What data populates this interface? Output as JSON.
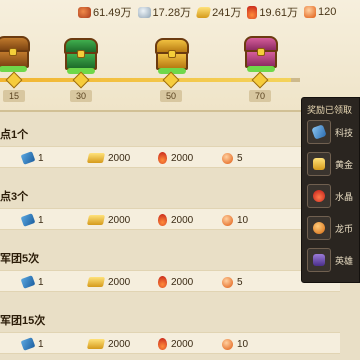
{
  "resources": [
    {
      "icon": "meat-icon",
      "value": "61.49万"
    },
    {
      "icon": "stone-icon",
      "value": "17.28万"
    },
    {
      "icon": "gold-bar-icon",
      "value": "241万"
    },
    {
      "icon": "flame-crystal-icon",
      "value": "19.61万"
    },
    {
      "icon": "orb-coin-icon",
      "value": "120"
    }
  ],
  "milestones": [
    {
      "label": "15",
      "chest": "brown"
    },
    {
      "label": "30",
      "chest": "green"
    },
    {
      "label": "50",
      "chest": "gold"
    },
    {
      "label": "70",
      "chest": "pink"
    }
  ],
  "progress_fraction": 0.97,
  "tasks": [
    {
      "title": "点1个",
      "rewards": [
        "1",
        "2000",
        "2000",
        "5"
      ]
    },
    {
      "title": "点3个",
      "rewards": [
        "1",
        "2000",
        "2000",
        "10"
      ]
    },
    {
      "title": "军团5次",
      "rewards": [
        "1",
        "2000",
        "2000",
        "5"
      ]
    },
    {
      "title": "军团15次",
      "rewards": [
        "1",
        "2000",
        "2000",
        "10"
      ]
    }
  ],
  "popup": {
    "title": "奖励已领取",
    "items": [
      {
        "icon": "tech-scroll-icon",
        "label": "科技"
      },
      {
        "icon": "gold-icon",
        "label": "黄金"
      },
      {
        "icon": "crystal-icon",
        "label": "水晶"
      },
      {
        "icon": "coin-icon",
        "label": "龙币"
      },
      {
        "icon": "hero-icon",
        "label": "英雄"
      }
    ]
  }
}
